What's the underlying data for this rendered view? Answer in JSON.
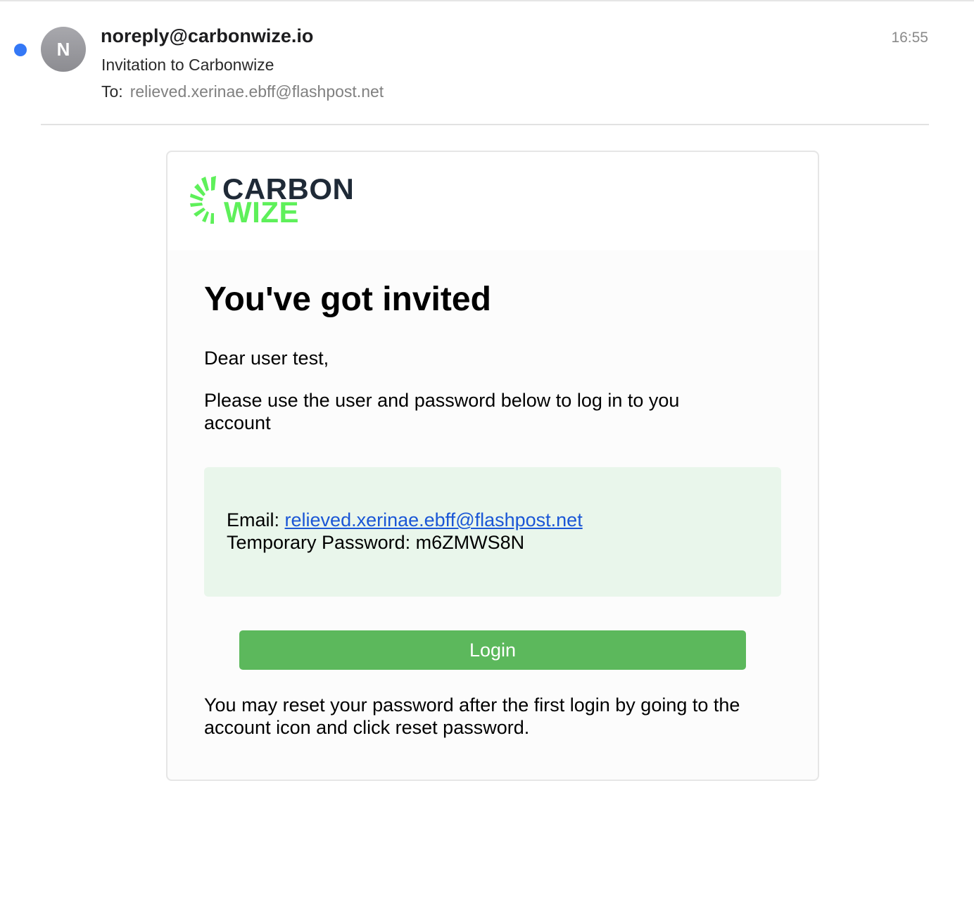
{
  "header": {
    "avatar_initial": "N",
    "sender": "noreply@carbonwize.io",
    "subject": "Invitation to Carbonwize",
    "to_label": "To:",
    "to_address": "relieved.xerinae.ebff@flashpost.net",
    "time": "16:55",
    "unread_dot_color": "#3478f6"
  },
  "email": {
    "logo": {
      "line1": "CARBON",
      "line2": "WIZE",
      "icon": "carbonwize-burst-icon"
    },
    "headline": "You've got invited",
    "greeting": "Dear user test,",
    "instructions": "Please use the user and password below to log in to you account",
    "credentials": {
      "email_label": "Email:",
      "email_value": "relieved.xerinae.ebff@flashpost.net",
      "password_label": "Temporary Password:",
      "password_value": "m6ZMWS8N"
    },
    "login_button": "Login",
    "footer_note": "You may reset your password after the first login by going to the account icon and click reset password."
  },
  "colors": {
    "brand_green": "#5ef05a",
    "brand_dark": "#1f2a37",
    "button_green": "#5cb85c",
    "cred_box_bg": "#e9f6eb",
    "link_blue": "#1a56d6"
  }
}
